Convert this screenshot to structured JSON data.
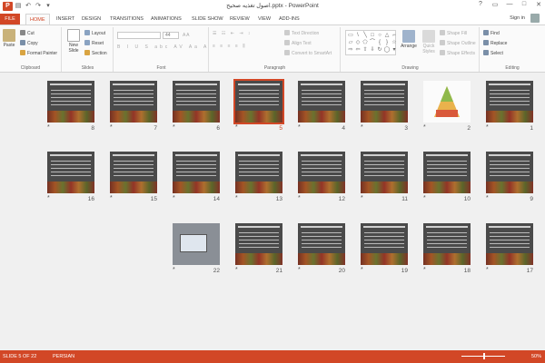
{
  "window": {
    "title": "اصول تغذیه صحیح.pptx - PowerPoint",
    "controls": [
      "?",
      "▭",
      "—",
      "□",
      "✕"
    ]
  },
  "tabs": [
    "FILE",
    "HOME",
    "INSERT",
    "DESIGN",
    "TRANSITIONS",
    "ANIMATIONS",
    "SLIDE SHOW",
    "REVIEW",
    "VIEW",
    "ADD-INS"
  ],
  "user": {
    "signin": "Sign in"
  },
  "ribbon": {
    "clipboard": {
      "label": "Clipboard",
      "paste": "Paste",
      "cut": "Cut",
      "copy": "Copy",
      "format_painter": "Format Painter"
    },
    "slides": {
      "label": "Slides",
      "new_slide": "New Slide",
      "layout": "Layout",
      "reset": "Reset",
      "section": "Section"
    },
    "font": {
      "label": "Font",
      "size": "44"
    },
    "paragraph": {
      "label": "Paragraph",
      "text_direction": "Text Direction",
      "align_text": "Align Text",
      "smartart": "Convert to SmartArt"
    },
    "drawing": {
      "label": "Drawing",
      "arrange": "Arrange",
      "quick_styles": "Quick Styles",
      "shape_fill": "Shape Fill",
      "shape_outline": "Shape Outline",
      "shape_effects": "Shape Effects"
    },
    "editing": {
      "label": "Editing",
      "find": "Find",
      "replace": "Replace",
      "select": "Select"
    }
  },
  "slides": [
    {
      "num": "1",
      "style": "dark"
    },
    {
      "num": "2",
      "style": "white"
    },
    {
      "num": "3",
      "style": "dark"
    },
    {
      "num": "4",
      "style": "dark"
    },
    {
      "num": "5",
      "style": "dark",
      "selected": true
    },
    {
      "num": "6",
      "style": "dark"
    },
    {
      "num": "7",
      "style": "dark"
    },
    {
      "num": "8",
      "style": "dark"
    },
    {
      "num": "9",
      "style": "dark"
    },
    {
      "num": "10",
      "style": "dark"
    },
    {
      "num": "11",
      "style": "dark"
    },
    {
      "num": "12",
      "style": "dark"
    },
    {
      "num": "13",
      "style": "dark"
    },
    {
      "num": "14",
      "style": "dark"
    },
    {
      "num": "15",
      "style": "dark"
    },
    {
      "num": "16",
      "style": "dark"
    },
    {
      "num": "17",
      "style": "dark"
    },
    {
      "num": "18",
      "style": "dark"
    },
    {
      "num": "19",
      "style": "dark"
    },
    {
      "num": "20",
      "style": "dark"
    },
    {
      "num": "21",
      "style": "dark"
    },
    {
      "num": "22",
      "style": "photo"
    }
  ],
  "status": {
    "slide_info": "SLIDE 5 OF 22",
    "language": "PERSIAN",
    "zoom": "50%"
  },
  "colors": {
    "accent": "#d24726"
  }
}
